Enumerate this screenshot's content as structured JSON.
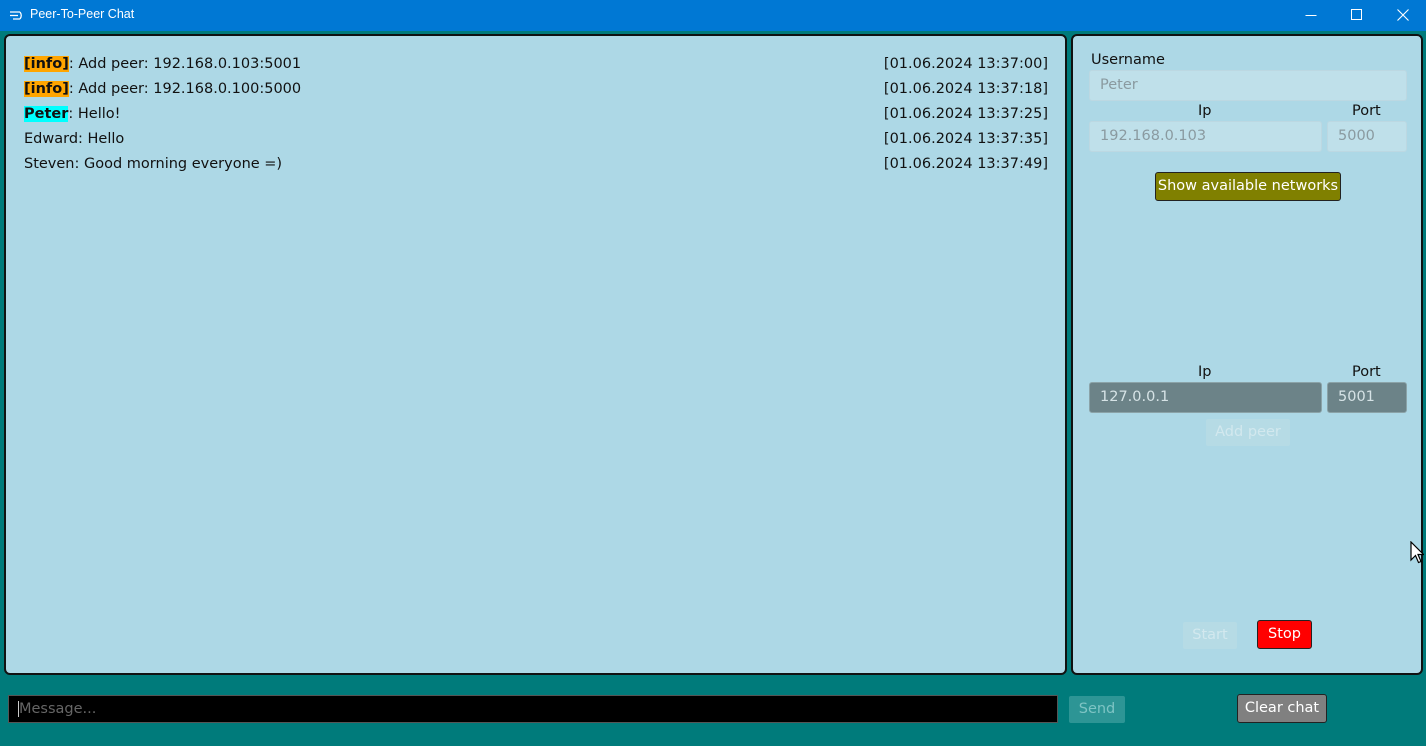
{
  "window": {
    "title": "Peer-To-Peer Chat",
    "icons": {
      "app": "chat-lines-icon",
      "minimize": "minimize-icon",
      "maximize": "maximize-icon",
      "close": "close-icon"
    }
  },
  "chat": {
    "messages": [
      {
        "sender": "[info]",
        "text": ": Add peer: 192.168.0.103:5001",
        "time": "[01.06.2024 13:37:00]",
        "highlight": "#ffa500"
      },
      {
        "sender": "[info]",
        "text": ": Add peer: 192.168.0.100:5000",
        "time": "[01.06.2024 13:37:18]",
        "highlight": "#ffa500"
      },
      {
        "sender": "Peter",
        "text": ": Hello!",
        "time": "[01.06.2024 13:37:25]",
        "highlight": "#00ffff"
      },
      {
        "sender": "Edward",
        "text": ": Hello",
        "time": "[01.06.2024 13:37:35]"
      },
      {
        "sender": "Steven",
        "text": ": Good morning everyone =)",
        "time": "[01.06.2024 13:37:49]"
      }
    ]
  },
  "settings": {
    "username_label": "Username",
    "username_value": "Peter",
    "local_ip_label": "Ip",
    "local_port_label": "Port",
    "local_ip_value": "192.168.0.103",
    "local_port_value": "5000",
    "show_networks_label": "Show available networks",
    "peer_ip_label": "Ip",
    "peer_port_label": "Port",
    "peer_ip_value": "127.0.0.1",
    "peer_port_value": "5001",
    "add_peer_label": "Add peer",
    "start_label": "Start",
    "stop_label": "Stop"
  },
  "composer": {
    "placeholder": "Message...",
    "send_label": "Send",
    "clear_label": "Clear chat"
  },
  "colors": {
    "titlebar": "#0078d4",
    "background": "#007b7b",
    "panel": "#add8e6",
    "info_highlight": "#ffa500",
    "self_highlight": "#00ffff",
    "networks_button": "#808000",
    "stop_button": "#ff0000",
    "clear_button": "#808080"
  }
}
